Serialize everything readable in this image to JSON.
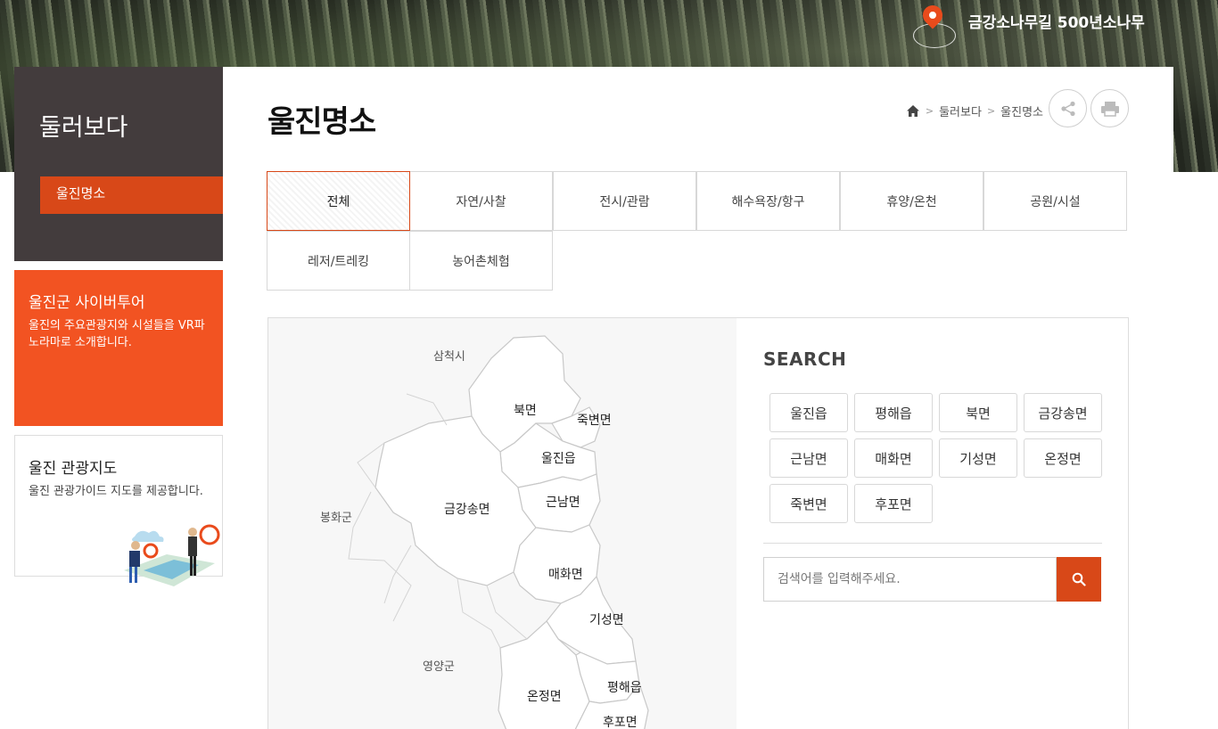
{
  "hero": {
    "location_text": "금강소나무길 500년소나무"
  },
  "sidebar": {
    "title": "둘러보다",
    "items": [
      {
        "label": "울진명소"
      }
    ]
  },
  "promo": {
    "tour": {
      "title": "울진군 사이버투어",
      "desc": "울진의 주요관광지와 시설들을 VR파노라마로 소개합니다."
    },
    "map": {
      "title": "울진 관광지도",
      "desc": "울진 관광가이드 지도를 제공합니다."
    }
  },
  "page": {
    "title": "울진명소"
  },
  "breadcrumb": {
    "level1": "둘러보다",
    "level2": "울진명소"
  },
  "tabs": [
    "전체",
    "자연/사찰",
    "전시/관람",
    "해수욕장/항구",
    "휴양/온천",
    "공원/시설",
    "레저/트레킹",
    "농어촌체험"
  ],
  "active_tab": "전체",
  "map": {
    "outside": {
      "samcheok": "삼척시",
      "bonghwa": "봉화군",
      "yeongyang": "영양군"
    },
    "regions": {
      "bukmyeon": "북면",
      "jukbyeon": "죽변면",
      "uljin": "울진읍",
      "geumgang": "금강송면",
      "geunnam": "근남면",
      "maehwa": "매화면",
      "giseong": "기성면",
      "onjeong": "온정면",
      "pyeonghae": "평해읍",
      "hupo": "후포면"
    }
  },
  "search": {
    "heading": "SEARCH",
    "chips": [
      "울진읍",
      "평해읍",
      "북면",
      "금강송면",
      "근남면",
      "매화면",
      "기성면",
      "온정면",
      "죽변면",
      "후포면"
    ],
    "placeholder": "검색어를 입력해주세요."
  },
  "colors": {
    "accent": "#d84818",
    "promo": "#f25322",
    "sidebar": "#433c3d"
  }
}
